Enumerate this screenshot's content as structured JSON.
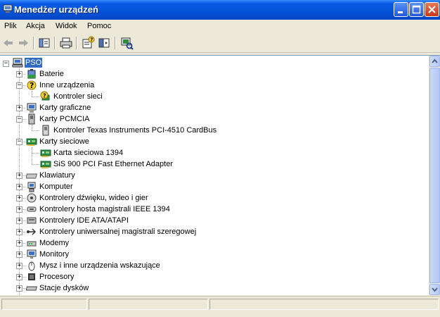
{
  "window": {
    "title": "Menedżer urządzeń",
    "min_icon": "minimize-icon",
    "max_icon": "maximize-icon",
    "close_icon": "close-icon"
  },
  "menu": [
    {
      "label": "Plik"
    },
    {
      "label": "Akcja"
    },
    {
      "label": "Widok"
    },
    {
      "label": "Pomoc"
    }
  ],
  "toolbar": {
    "icons": [
      "back-arrow-icon",
      "forward-arrow-icon",
      "show-hide-tree-icon",
      "print-icon",
      "properties-icon",
      "help-icon",
      "scan-hardware-icon"
    ]
  },
  "tree": {
    "root": {
      "label": "PSO",
      "icon": "computer-icon"
    },
    "nodes": [
      {
        "label": "Baterie",
        "icon": "battery-icon",
        "expanded": false
      },
      {
        "label": "Inne urządzenia",
        "icon": "unknown-device-icon",
        "expanded": true
      },
      {
        "label": "Kontroler sieci",
        "icon": "warning-device-icon",
        "child": true
      },
      {
        "label": "Karty graficzne",
        "icon": "display-adapter-icon",
        "expanded": false
      },
      {
        "label": "Karty PCMCIA",
        "icon": "pcmcia-icon",
        "expanded": true
      },
      {
        "label": "Kontroler Texas Instruments PCI-4510 CardBus",
        "icon": "pcmcia-card-icon",
        "child": true
      },
      {
        "label": "Karty sieciowe",
        "icon": "network-card-icon",
        "expanded": true
      },
      {
        "label": "Karta sieciowa 1394",
        "icon": "network-card-icon",
        "child": true
      },
      {
        "label": "SiS 900 PCI Fast Ethernet Adapter",
        "icon": "network-card-icon",
        "child": true
      },
      {
        "label": "Klawiatury",
        "icon": "keyboard-icon",
        "expanded": false
      },
      {
        "label": "Komputer",
        "icon": "computer-monitor-icon",
        "expanded": false
      },
      {
        "label": "Kontrolery dźwięku, wideo i gier",
        "icon": "sound-icon",
        "expanded": false
      },
      {
        "label": "Kontrolery hosta magistrali IEEE 1394",
        "icon": "ieee1394-icon",
        "expanded": false
      },
      {
        "label": "Kontrolery IDE ATA/ATAPI",
        "icon": "ide-controller-icon",
        "expanded": false
      },
      {
        "label": "Kontrolery uniwersalnej magistrali szeregowej",
        "icon": "usb-icon",
        "expanded": false
      },
      {
        "label": "Modemy",
        "icon": "modem-icon",
        "expanded": false
      },
      {
        "label": "Monitory",
        "icon": "monitor-icon",
        "expanded": false
      },
      {
        "label": "Mysz i inne urządzenia wskazujące",
        "icon": "mouse-icon",
        "expanded": false
      },
      {
        "label": "Procesory",
        "icon": "processor-icon",
        "expanded": false
      },
      {
        "label": "Stacje dysków",
        "icon": "disk-drive-icon",
        "expanded": false
      }
    ]
  },
  "colors": {
    "titlebar": "#0453d8",
    "selection": "#316ac5"
  }
}
